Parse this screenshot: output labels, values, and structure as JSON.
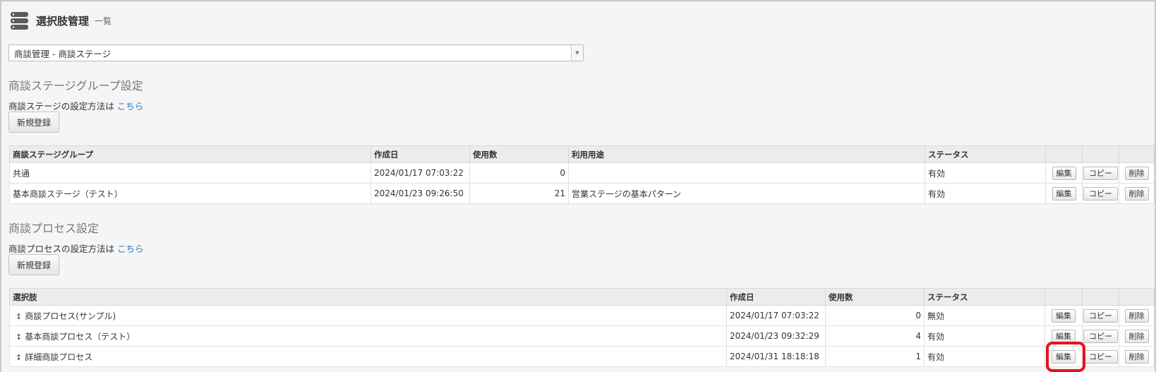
{
  "header": {
    "title": "選択肢管理",
    "subtitle": "一覧",
    "icon": "database-icon"
  },
  "category_select": {
    "value": "商談管理 - 商談ステージ"
  },
  "stage_group_section": {
    "title": "商談ステージグループ設定",
    "help_text": "商談ステージの設定方法は",
    "help_link": "こちら",
    "new_button": "新規登録",
    "columns": [
      "商談ステージグループ",
      "作成日",
      "使用数",
      "利用用途",
      "ステータス"
    ],
    "rows": [
      {
        "name": "共通",
        "created": "2024/01/17 07:03:22",
        "count": "0",
        "usage": "",
        "status": "有効"
      },
      {
        "name": "基本商談ステージ（テスト）",
        "created": "2024/01/23 09:26:50",
        "count": "21",
        "usage": "営業ステージの基本パターン",
        "status": "有効"
      }
    ]
  },
  "process_section": {
    "title": "商談プロセス設定",
    "help_text": "商談プロセスの設定方法は",
    "help_link": "こちら",
    "new_button": "新規登録",
    "columns": [
      "選択肢",
      "作成日",
      "使用数",
      "ステータス"
    ],
    "rows": [
      {
        "name": "商談プロセス(サンプル)",
        "created": "2024/01/17 07:03:22",
        "count": "0",
        "status": "無効"
      },
      {
        "name": "基本商談プロセス（テスト）",
        "created": "2024/01/23 09:32:29",
        "count": "4",
        "status": "有効"
      },
      {
        "name": "詳細商談プロセス",
        "created": "2024/01/31 18:18:18",
        "count": "1",
        "status": "有効"
      }
    ]
  },
  "actions": {
    "edit": "編集",
    "copy": "コピー",
    "delete": "削除"
  },
  "drag_glyph": "↕",
  "colors": {
    "link": "#2a77c8",
    "highlight": "#e8121b",
    "header_bg": "#ececec"
  }
}
